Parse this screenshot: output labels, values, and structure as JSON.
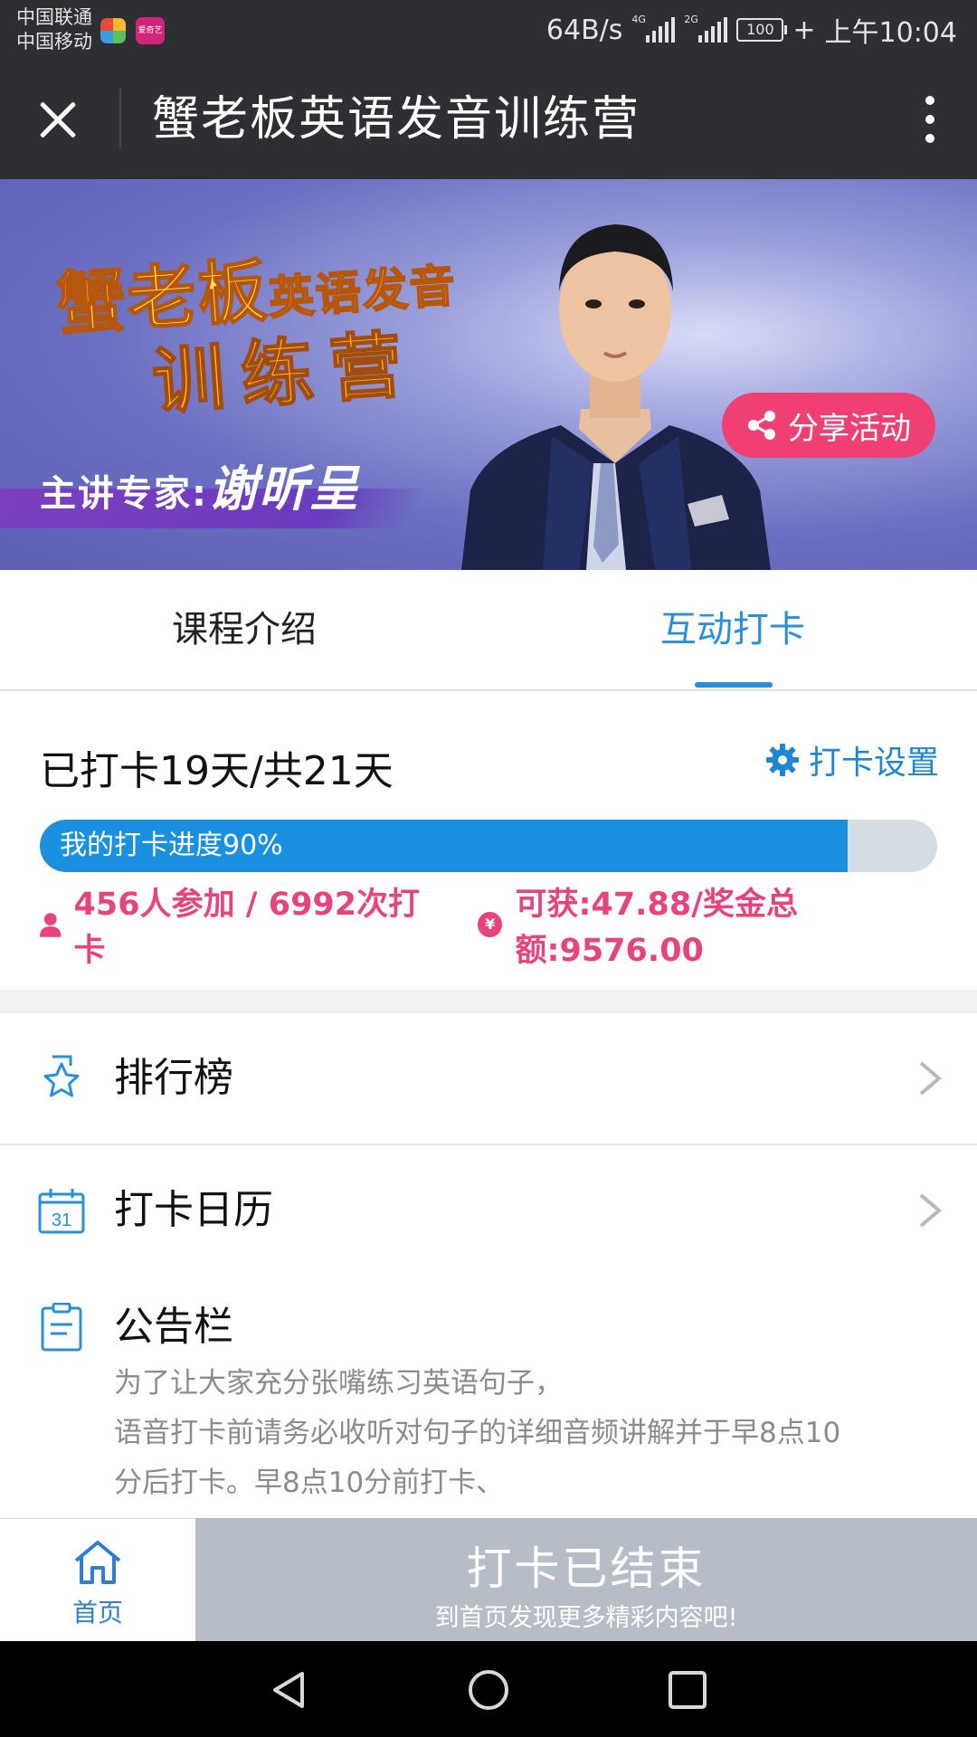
{
  "status_bar": {
    "carrier1": "中国联通",
    "carrier2": "中国移动",
    "app_badge": "爱奇艺",
    "net_speed": "64B/s",
    "sig1_tag": "4G",
    "sig2_tag": "2G",
    "battery": "100",
    "time": "上午10:04"
  },
  "titlebar": {
    "title": "蟹老板英语发音训练营"
  },
  "banner": {
    "line1a": "蟹老板",
    "line1b": "英语发音",
    "line2": "训练营",
    "expert_label": "主讲专家:",
    "expert_name": "谢昕呈",
    "share_label": "分享活动"
  },
  "tabs": [
    {
      "label": "课程介绍",
      "active": false
    },
    {
      "label": "互动打卡",
      "active": true
    }
  ],
  "checkin": {
    "days_text": "已打卡19天/共21天",
    "settings_label": "打卡设置",
    "progress_label": "我的打卡进度90%",
    "progress_percent": 90,
    "participants": "456人参加 / 6992次打卡",
    "coin_symbol": "¥",
    "bonus": "可获:47.88/奖金总额:9576.00"
  },
  "menu": [
    {
      "label": "排行榜",
      "icon": "star-bookmark-icon"
    },
    {
      "label": "打卡日历",
      "icon": "calendar-icon",
      "icon_text": "31"
    }
  ],
  "notice": {
    "title": "公告栏",
    "lines": [
      "为了让大家充分张嘴练习英语句子，",
      "语音打卡前请务必收听对句子的详细音频讲解并于早8点10",
      "分后打卡。早8点10分前打卡、"
    ]
  },
  "bottom": {
    "home_label": "首页",
    "ended_title": "打卡已结束",
    "ended_sub": "到首页发现更多精彩内容吧!"
  },
  "colors": {
    "accent_blue": "#2a8fd8",
    "progress_blue": "#1b8fe0",
    "stat_pink": "#e8437a",
    "share_pink": "#ef3f73",
    "ended_gray": "#b6bdc7"
  }
}
